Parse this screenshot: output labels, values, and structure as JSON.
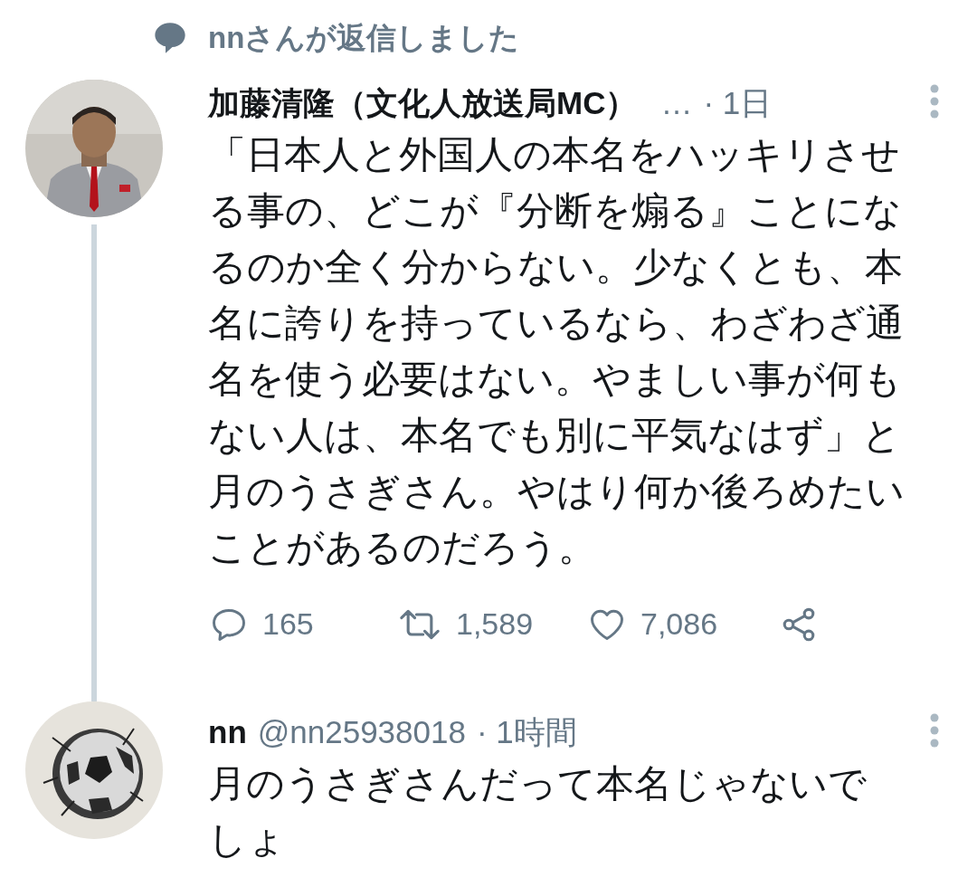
{
  "context": {
    "text": "nnさんが返信しました"
  },
  "tweets": [
    {
      "kind": "parent",
      "name": "加藤清隆（文化人放送局MC）",
      "handle": "…",
      "time": "· 1日",
      "text": "「日本人と外国人の本名をハッキリさせる事の、どこが『分断を煽る』ことになるのか全く分からない。少なくとも、本名に誇りを持っているなら、わざわざ通名を使う必要はない。やましい事が何もない人は、本名でも別に平気なはず」と月のうさぎさん。やはり何か後ろめたいことがあるのだろう。",
      "thread_line": true,
      "actions": [
        {
          "kind": "reply",
          "count": "165"
        },
        {
          "kind": "retweet",
          "count": "1,589"
        },
        {
          "kind": "like",
          "count": "7,086"
        },
        {
          "kind": "share"
        }
      ]
    },
    {
      "kind": "reply",
      "name": "nn",
      "handle": "@nn25938018",
      "time": "· 1時間",
      "text": "月のうさぎさんだって本名じゃないでしょ",
      "thread_line": false
    }
  ]
}
